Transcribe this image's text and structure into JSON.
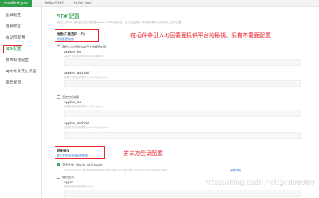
{
  "tabs": [
    {
      "label": "manifest.json",
      "active": true
    },
    {
      "label": "index.html",
      "active": false
    },
    {
      "label": "index.vue",
      "active": false
    }
  ],
  "sidebar": {
    "items": [
      {
        "label": "基础配置"
      },
      {
        "label": "图标配置"
      },
      {
        "label": "启动图配置"
      },
      {
        "label": "SDK配置",
        "active": true
      },
      {
        "label": "模块权限配置"
      },
      {
        "label": "App常用其它设置"
      },
      {
        "label": "源码视图"
      }
    ]
  },
  "sdk": {
    "title": "SDK配置",
    "desc": "使用三方SDK，需在此设定它的密钥和appkey等申请后的值；云打包会生效。本地打包需自行修改原生工程中配置。",
    "map": {
      "heading": "地图(只能选择一个)",
      "link": "地图配置指南",
      "amap_option": "高德定位地图(mac不支持高德地图)",
      "amap_ios_label": "appkey_ios",
      "amap_ios_hint": "高德开放平台申请的ios平台appkey",
      "amap_android_label": "appkey_android",
      "amap_android_hint": "高德开放平台申请的android平台appkey",
      "baidu_option": "百度定位地图",
      "baidu_ios_label": "appkey_ios",
      "baidu_ios_hint": "百度开放平台申请的ios平台appkey",
      "baidu_android_label": "appkey_android",
      "baidu_android_hint": "百度开放平台申请的android平台appkey"
    },
    "login": {
      "heading": "登录鉴权",
      "link": "第三方登录鉴权配置指南",
      "apple_option": "苹果登录（Sign in with Apple）",
      "apple_desc": "仅iOS13+支持，需在Apple开发者中心配置App ID开启此功能，并在App打包中配置对应权限",
      "apple_link": "参考文档",
      "wechat_option": "微信登录",
      "appid_label": "appid",
      "appid_hint": "微信开放平台申请的appid"
    }
  },
  "annotations": {
    "map_note": "在插件中引入地图需要提供平台的秘钥，没有不需要配置",
    "login_note": "第三方登录配置"
  },
  "watermark": "https://blog.csdn.net/gd898989",
  "colors": {
    "accent": "#2e9e47",
    "annotation": "#e8232a",
    "link": "#2b7bd6"
  }
}
